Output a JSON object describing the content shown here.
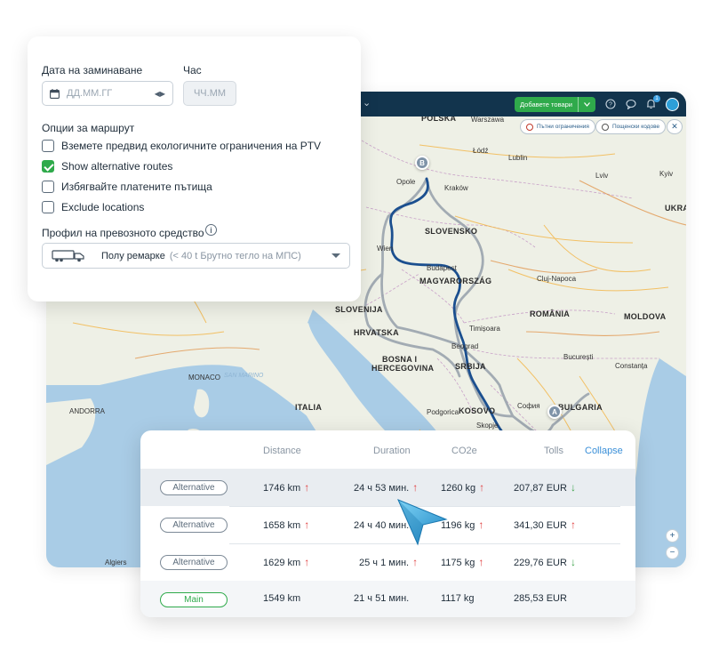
{
  "options": {
    "date_label": "Дата на заминаване",
    "time_label": "Час",
    "date_placeholder": "ДД.ММ.ГГ",
    "time_placeholder": "ЧЧ.ММ",
    "route_options_label": "Опции за маршрут",
    "checkboxes": [
      {
        "label": "Вземете предвид екологичните ограничения на PTV",
        "checked": false
      },
      {
        "label": "Show alternative routes",
        "checked": true
      },
      {
        "label": "Избягвайте платените пътища",
        "checked": false
      },
      {
        "label": "Exclude locations",
        "checked": false
      }
    ],
    "vehicle_profile_label": "Профил на превозното средство",
    "vehicle_name": "Полу ремарке",
    "vehicle_detail": "(< 40 t Брутно тегло на МПС)"
  },
  "topbar": {
    "add_goods": "Добавете товари",
    "notification_count": "1"
  },
  "map": {
    "chips": [
      "Пътни ограничения",
      "Пощенски кодове"
    ],
    "markers": {
      "start": "A",
      "end": "B"
    },
    "labels": {
      "polska": "POLSKA",
      "warszawa": "Warszawa",
      "opole": "Opole",
      "krakow": "Kraków",
      "slovensko": "SLOVENSKO",
      "wien": "Wien",
      "budapest": "Budapest",
      "magyarorszag": "MAGYARORSZÁG",
      "slovenija": "SLOVENIJA",
      "hrvatska": "HRVATSKA",
      "bosna": "BOSNA I",
      "hercegovina": "HERCEGOVINA",
      "beograd": "Beograd",
      "srbija": "SRBIJA",
      "sofia": "София",
      "bulgaria": "BULGARIA",
      "romania": "ROMÂNIA",
      "bucuresti": "București",
      "moldova": "MOLDOVA",
      "ukraine": "UKRA",
      "kyiv": "Kyiv",
      "kosovo": "KOSOVO",
      "podgorica": "Podgorica",
      "skopje": "Skopje",
      "italia": "ITALIA",
      "monaco": "MONACO",
      "andorra": "ANDORRA",
      "san_marino": "SAN MARINO",
      "algiers": "Algiers",
      "lodz": "Łódź",
      "lublin": "Lublin",
      "lviv": "Lviv",
      "cluj": "Cluj-Napoca",
      "timisoara": "Timișoara",
      "constanta": "Constanța"
    },
    "zoom_in": "+",
    "zoom_out": "−"
  },
  "routes": {
    "headers": {
      "distance": "Distance",
      "duration": "Duration",
      "co2e": "CO2e",
      "tolls": "Tolls"
    },
    "collapse": "Collapse",
    "rows": [
      {
        "type": "Alternative",
        "distance": "1746 km",
        "duration": "24 ч 53 мин.",
        "co2e": "1260 kg",
        "tolls": "207,87 EUR"
      },
      {
        "type": "Alternative",
        "distance": "1658 km",
        "duration": "24 ч 40 мин.",
        "co2e": "1196 kg",
        "tolls": "341,30 EUR"
      },
      {
        "type": "Alternative",
        "distance": "1629 km",
        "duration": "25 ч 1 мин.",
        "co2e": "1175 kg",
        "tolls": "229,76 EUR"
      },
      {
        "type": "Main",
        "distance": "1549 km",
        "duration": "21 ч 51 мин.",
        "co2e": "1117 kg",
        "tolls": "285,53 EUR"
      }
    ],
    "arrows": {
      "up": "↑",
      "down": "↓"
    }
  },
  "colors": {
    "accent_green": "#2faa4b",
    "topbar_navy": "#12344d",
    "route_main": "#1b4f8f",
    "route_alt": "#9aa4ae",
    "link_blue": "#3a8fd8",
    "arrow_red": "#e03c3c",
    "arrow_green": "#3ca34a"
  },
  "icons": [
    "calendar-icon",
    "stepper-arrows-icon",
    "info-icon",
    "truck-trailer-icon",
    "chevron-down-icon",
    "help-icon",
    "chat-icon",
    "bell-icon",
    "avatar",
    "no-entry-icon",
    "postcode-icon",
    "close-icon",
    "cursor-arrow-icon"
  ]
}
